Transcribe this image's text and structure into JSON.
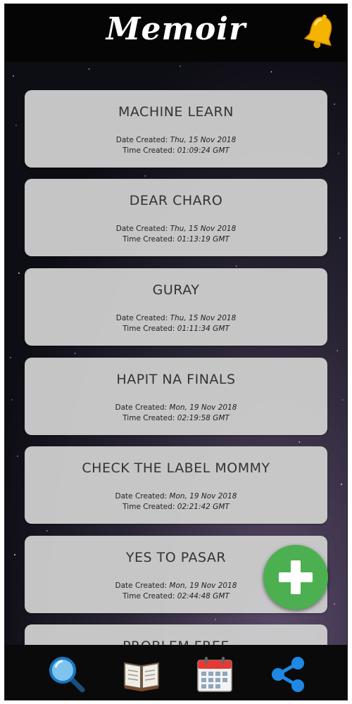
{
  "app": {
    "title": "Memoir"
  },
  "labels": {
    "date_created": "Date Created:",
    "time_created": "Time Created:"
  },
  "entries": [
    {
      "title": "MACHINE LEARN",
      "date": "Thu, 15 Nov 2018",
      "time": "01:09:24 GMT"
    },
    {
      "title": "DEAR CHARO",
      "date": "Thu, 15 Nov 2018",
      "time": "01:13:19 GMT"
    },
    {
      "title": "GURAY",
      "date": "Thu, 15 Nov 2018",
      "time": "01:11:34 GMT"
    },
    {
      "title": "HAPIT NA FINALS",
      "date": "Mon, 19 Nov 2018",
      "time": "02:19:58 GMT"
    },
    {
      "title": "CHECK THE LABEL MOMMY",
      "date": "Mon, 19 Nov 2018",
      "time": "02:21:42 GMT"
    },
    {
      "title": "YES TO PASAR",
      "date": "Mon, 19 Nov 2018",
      "time": "02:44:48 GMT"
    },
    {
      "title": "PROBLEM FREE",
      "date": "",
      "time": ""
    }
  ],
  "icons": {
    "header": "bell-icon",
    "fab": "plus-icon",
    "nav": [
      "search-icon",
      "book-icon",
      "calendar-icon",
      "share-icon"
    ]
  },
  "colors": {
    "fab": "#4cb050",
    "bars": "#050505",
    "card": "#cdcdcd",
    "bell": "#f5b400",
    "share": "#1e88e5"
  }
}
